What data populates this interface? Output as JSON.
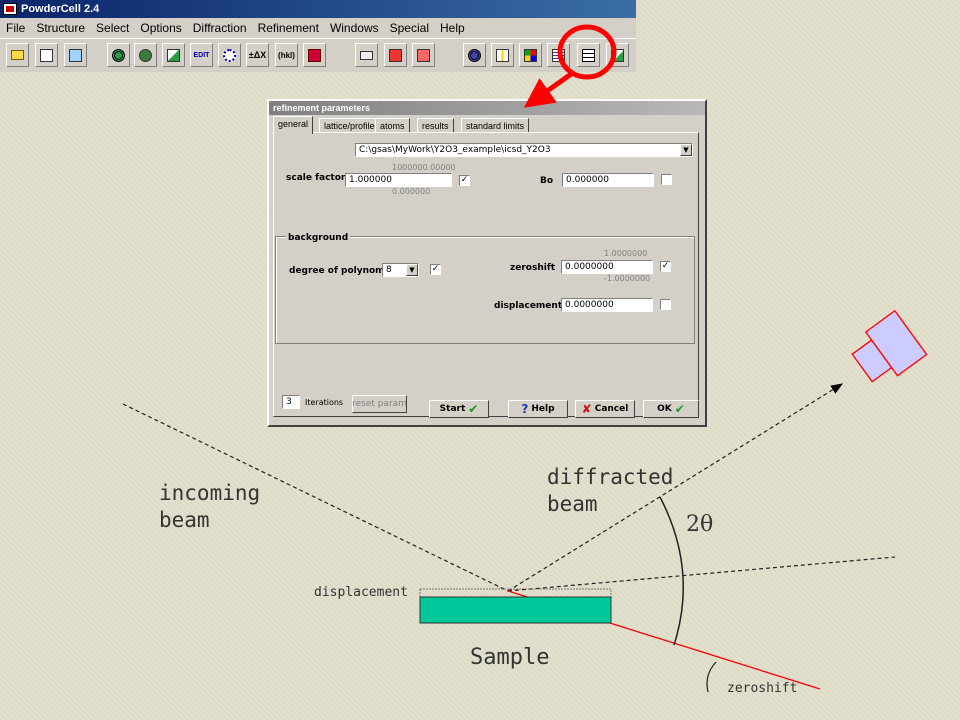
{
  "app": {
    "title": "PowderCell 2.4",
    "menu": [
      "File",
      "Structure",
      "Select",
      "Options",
      "Diffraction",
      "Refinement",
      "Windows",
      "Special",
      "Help"
    ],
    "toolbar": {
      "edit_label": "EDIT",
      "delta_label": "±ΔX",
      "hkl_label": "(hkl)"
    }
  },
  "dialog": {
    "title": "refinement parameters",
    "tabs": [
      "general",
      "lattice/profile",
      "atoms",
      "results",
      "standard limits"
    ],
    "path": "C:\\gsas\\MyWork\\Y2O3_example\\icsd_Y2O3",
    "scale_factor": {
      "label": "scale factor",
      "value": "1.000000",
      "upper": "1000000.00000",
      "lower": "0.000000",
      "checked": "✓"
    },
    "bo": {
      "label": "Bo",
      "value": "0.000000"
    },
    "background": {
      "title": "background",
      "degree_label": "degree of polynom",
      "degree_value": "8",
      "degree_checked": "✓",
      "zeroshift": {
        "label": "zeroshift",
        "value": "0.0000000",
        "upper": "1.0000000",
        "lower": "-1.0000000",
        "checked": "✓"
      },
      "displacement": {
        "label": "displacement",
        "value": "0.0000000"
      }
    },
    "iterations": {
      "value": "3",
      "label": "Iterations"
    },
    "buttons": {
      "reset": "reset param",
      "start": "Start",
      "help": "Help",
      "cancel": "Cancel",
      "ok": "OK"
    }
  },
  "diagram": {
    "incoming": "incoming\nbeam",
    "diffracted": "diffracted\nbeam",
    "two_theta": "2θ",
    "displacement": "displacement",
    "sample": "Sample",
    "zeroshift": "zeroshift",
    "colors": {
      "sample": "#00c89a",
      "zeroshift_line": "#ff0000",
      "highlight": "#ff0000",
      "detector": "#ccccff"
    }
  }
}
